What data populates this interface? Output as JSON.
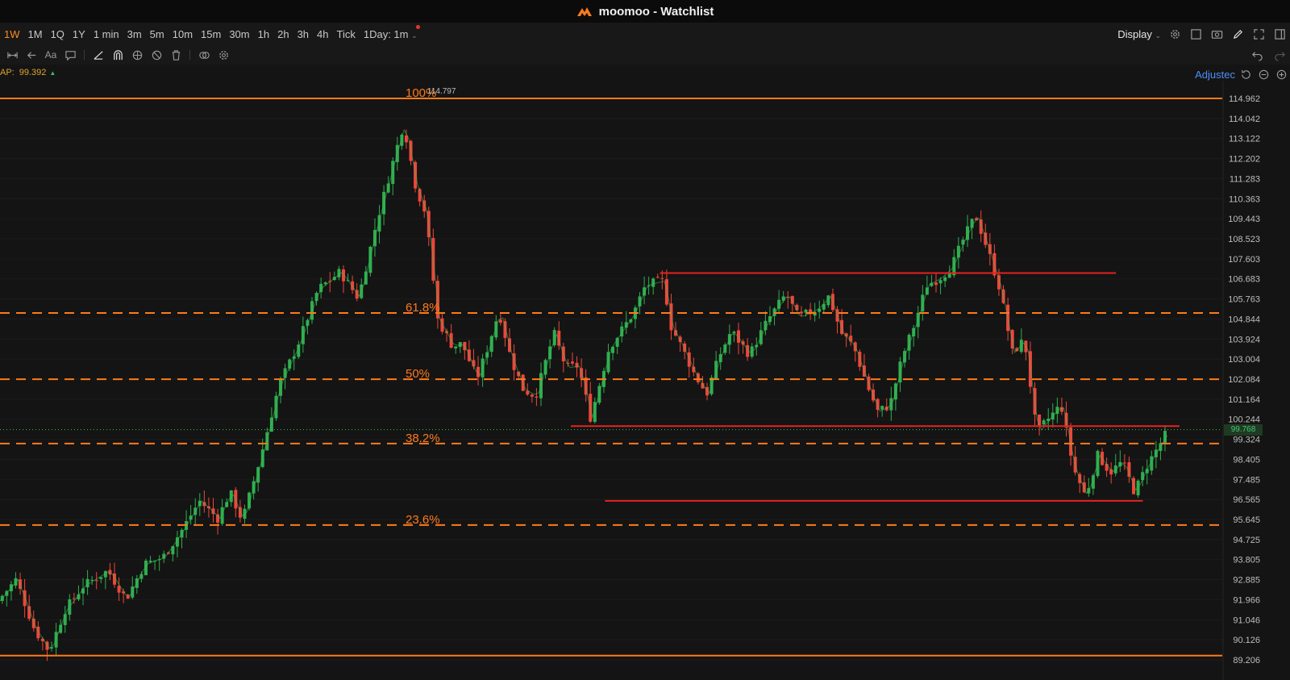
{
  "window": {
    "title": "moomoo - Watchlist"
  },
  "timeframes": [
    {
      "label": "1W",
      "active": true
    },
    {
      "label": "1M"
    },
    {
      "label": "1Q"
    },
    {
      "label": "1Y"
    },
    {
      "label": "1 min"
    },
    {
      "label": "3m"
    },
    {
      "label": "5m"
    },
    {
      "label": "10m"
    },
    {
      "label": "15m"
    },
    {
      "label": "30m"
    },
    {
      "label": "1h"
    },
    {
      "label": "2h"
    },
    {
      "label": "3h"
    },
    {
      "label": "4h"
    },
    {
      "label": "Tick"
    },
    {
      "label": "1Day: 1m",
      "dropdown": true,
      "badge": true
    }
  ],
  "toolbar_right": {
    "display_label": "Display"
  },
  "indicator": {
    "label": "AP:",
    "value": "99.392",
    "trend": "up"
  },
  "adjust_label": "Adjustec",
  "colors": {
    "up": "#2fae4f",
    "down": "#f0453a",
    "fib": "#ff7a1a",
    "level": "#e8211c",
    "accent": "#ff8b1f",
    "link": "#4e8ef7"
  },
  "chart_data": {
    "type": "candlestick",
    "ylim": [
      89.206,
      114.962
    ],
    "y_ticks": [
      "114.962",
      "114.042",
      "113.122",
      "112.202",
      "111.283",
      "110.363",
      "109.443",
      "108.523",
      "107.603",
      "106.683",
      "105.763",
      "104.844",
      "103.924",
      "103.004",
      "102.084",
      "101.164",
      "100.244",
      "99.324",
      "98.405",
      "97.485",
      "96.565",
      "95.645",
      "94.725",
      "93.805",
      "92.885",
      "91.966",
      "91.046",
      "90.126",
      "89.206"
    ],
    "current_price": "99.768",
    "high_label": "114.797",
    "fibonacci": [
      {
        "label": "100%",
        "value": 114.962,
        "style": "solid"
      },
      {
        "label": "61.8%",
        "value": 105.12,
        "style": "dashed"
      },
      {
        "label": "50%",
        "value": 102.08,
        "style": "dashed"
      },
      {
        "label": "38.2%",
        "value": 99.13,
        "style": "dashed"
      },
      {
        "label": "23.6%",
        "value": 95.39,
        "style": "dashed"
      },
      {
        "label": "",
        "value": 89.4,
        "style": "solid"
      }
    ],
    "horizontal_levels": [
      {
        "value": 106.95,
        "x_start": 0.54,
        "x_end": 0.913
      },
      {
        "value": 99.93,
        "x_start": 0.467,
        "x_end": 0.965
      },
      {
        "value": 96.5,
        "x_start": 0.495,
        "x_end": 0.935
      }
    ],
    "path": [
      [
        0.0,
        91.9
      ],
      [
        0.015,
        92.9
      ],
      [
        0.03,
        90.6
      ],
      [
        0.042,
        89.6
      ],
      [
        0.055,
        91.5
      ],
      [
        0.07,
        92.6
      ],
      [
        0.09,
        93.3
      ],
      [
        0.105,
        92.0
      ],
      [
        0.12,
        93.6
      ],
      [
        0.135,
        93.9
      ],
      [
        0.15,
        95.1
      ],
      [
        0.165,
        96.5
      ],
      [
        0.18,
        95.7
      ],
      [
        0.19,
        96.9
      ],
      [
        0.2,
        95.6
      ],
      [
        0.215,
        98.5
      ],
      [
        0.23,
        101.8
      ],
      [
        0.245,
        103.6
      ],
      [
        0.262,
        106.2
      ],
      [
        0.28,
        107.0
      ],
      [
        0.295,
        105.8
      ],
      [
        0.31,
        109.3
      ],
      [
        0.325,
        112.4
      ],
      [
        0.332,
        113.8
      ],
      [
        0.342,
        110.9
      ],
      [
        0.35,
        109.7
      ],
      [
        0.36,
        104.8
      ],
      [
        0.372,
        103.6
      ],
      [
        0.38,
        103.7
      ],
      [
        0.392,
        102.1
      ],
      [
        0.4,
        103.4
      ],
      [
        0.41,
        105.2
      ],
      [
        0.42,
        103.0
      ],
      [
        0.43,
        101.6
      ],
      [
        0.44,
        101.3
      ],
      [
        0.455,
        104.2
      ],
      [
        0.465,
        102.6
      ],
      [
        0.475,
        102.7
      ],
      [
        0.485,
        100.3
      ],
      [
        0.5,
        103.5
      ],
      [
        0.52,
        105.1
      ],
      [
        0.53,
        106.4
      ],
      [
        0.545,
        106.6
      ],
      [
        0.55,
        104.6
      ],
      [
        0.56,
        103.5
      ],
      [
        0.57,
        102.3
      ],
      [
        0.58,
        101.4
      ],
      [
        0.59,
        103.1
      ],
      [
        0.6,
        104.3
      ],
      [
        0.615,
        103.2
      ],
      [
        0.63,
        104.8
      ],
      [
        0.645,
        106.0
      ],
      [
        0.655,
        104.9
      ],
      [
        0.67,
        105.3
      ],
      [
        0.68,
        105.9
      ],
      [
        0.69,
        104.2
      ],
      [
        0.7,
        103.6
      ],
      [
        0.712,
        101.7
      ],
      [
        0.72,
        100.6
      ],
      [
        0.73,
        100.9
      ],
      [
        0.74,
        103.1
      ],
      [
        0.75,
        104.6
      ],
      [
        0.76,
        106.4
      ],
      [
        0.77,
        106.7
      ],
      [
        0.78,
        107.2
      ],
      [
        0.79,
        108.5
      ],
      [
        0.8,
        109.6
      ],
      [
        0.81,
        108.0
      ],
      [
        0.82,
        106.2
      ],
      [
        0.83,
        103.3
      ],
      [
        0.84,
        103.9
      ],
      [
        0.85,
        99.6
      ],
      [
        0.86,
        100.3
      ],
      [
        0.87,
        100.9
      ],
      [
        0.88,
        98.0
      ],
      [
        0.89,
        96.7
      ],
      [
        0.9,
        98.6
      ],
      [
        0.91,
        97.8
      ],
      [
        0.92,
        98.3
      ],
      [
        0.93,
        96.9
      ],
      [
        0.94,
        98.1
      ],
      [
        0.955,
        99.5
      ]
    ]
  }
}
